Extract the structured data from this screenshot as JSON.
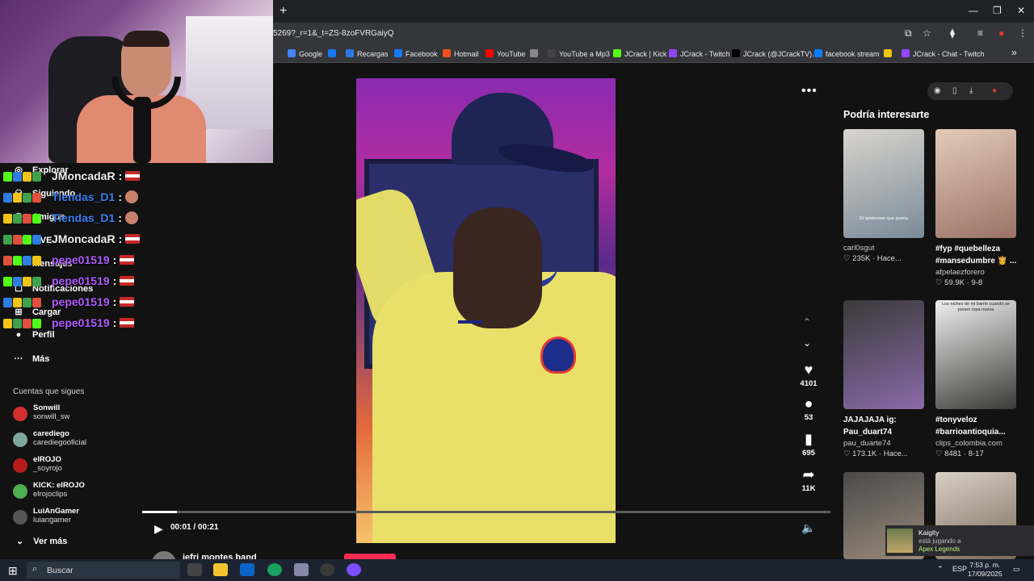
{
  "browser": {
    "new_tab": "+",
    "window_controls": [
      "—",
      "❐",
      "✕"
    ],
    "url": "5269?_r=1&_t=ZS-8zoFVRGaiyQ",
    "bookmarks": [
      {
        "label": "Google",
        "color": "#4285f4"
      },
      {
        "label": "",
        "color": "#1877f2"
      },
      {
        "label": "Recargas",
        "color": "#2a7ae2"
      },
      {
        "label": "Facebook",
        "color": "#1877f2"
      },
      {
        "label": "Hotmail",
        "color": "#f25022"
      },
      {
        "label": "YouTube",
        "color": "#ff0000"
      },
      {
        "label": "",
        "color": "#888888"
      },
      {
        "label": "YouTube a Mp3",
        "color": "#444444"
      },
      {
        "label": "JCrack | Kick",
        "color": "#53fc18"
      },
      {
        "label": "JCrack - Twitch",
        "color": "#9146ff"
      },
      {
        "label": "JCrack (@JCrackTV)...",
        "color": "#000000"
      },
      {
        "label": "facebook stream",
        "color": "#0a7cff"
      },
      {
        "label": "",
        "color": "#f1c40f"
      },
      {
        "label": "JCrack - Chat - Twitch",
        "color": "#9146ff"
      }
    ],
    "more_bookmarks": "»"
  },
  "chat": [
    {
      "user": "JMoncadaR",
      "sep": ":",
      "color": "#f0f0f0",
      "extra": "flag"
    },
    {
      "user": "Tiendas_D1",
      "sep": ":",
      "color": "#3b7ff2",
      "extra": "emote"
    },
    {
      "user": "Tiendas_D1",
      "sep": ":",
      "color": "#3b7ff2",
      "extra": "emote"
    },
    {
      "user": "JMoncadaR",
      "sep": ":",
      "color": "#f0f0f0",
      "extra": "flag"
    },
    {
      "user": "pepe01519",
      "sep": ":",
      "color": "#b05cff",
      "extra": "flag"
    },
    {
      "user": "pepe01519",
      "sep": ":",
      "color": "#b05cff",
      "extra": "flag"
    },
    {
      "user": "pepe01519",
      "sep": ":",
      "color": "#b05cff",
      "extra": "flag"
    },
    {
      "user": "pepe01519",
      "sep": ":",
      "color": "#b05cff",
      "extra": "flag"
    }
  ],
  "sidebar": {
    "nav": [
      "Explorar",
      "Siguiendo",
      "Amigos",
      "LIVE",
      "Mensajes",
      "Notificaciones",
      "Cargar",
      "Perfil",
      "Más"
    ],
    "following_title": "Cuentas que sigues",
    "following": [
      {
        "name": "Sonwill",
        "handle": "sonwill_sw",
        "color": "#d32f2f"
      },
      {
        "name": "carediego",
        "handle": "carediegooficial",
        "color": "#7fa6a0"
      },
      {
        "name": "elROJO",
        "handle": "_soyrojo",
        "color": "#b71c1c"
      },
      {
        "name": "KICK: elROJO",
        "handle": "elrojoclips",
        "color": "#4caf50"
      },
      {
        "name": "LuiAnGamer",
        "handle": "luiangamer",
        "color": "#555"
      }
    ],
    "see_more": "Ver más"
  },
  "player": {
    "likes": "4101",
    "comments": "53",
    "saves": "695",
    "shares": "11K",
    "time": "00:01 / 00:21",
    "progress": 0.05,
    "author": "jefri montes band"
  },
  "right_panel": {
    "title": "Podría interesarte",
    "cards": [
      {
        "thumb_text": "El spiderman que queria",
        "title": "",
        "user": "carl0sgut",
        "meta": "♡ 235K · Hace...",
        "colors": [
          "#d9d5cc",
          "#7a8a9a"
        ]
      },
      {
        "thumb_text": "",
        "title": "#fyp #quebelleza #mansedumbre 👸 ...",
        "user": "afpelaezforero",
        "meta": "♡ 59.9K · 9-8",
        "colors": [
          "#e3cbb9",
          "#9a7264"
        ]
      },
      {
        "thumb_text": "",
        "title": "JAJAJAJA ig: Pau_duart74",
        "user": "pau_duarte74",
        "meta": "♡ 173.1K · Hace...",
        "colors": [
          "#3a3a3a",
          "#8a6aa8"
        ]
      },
      {
        "thumb_text": "Los niches de mi barrio cuando se ponen ropa nueva",
        "title": "#tonyveloz #barrioantioquia...",
        "user": "clips_colombia.com",
        "meta": "♡ 8481 · 8-17",
        "colors": [
          "#f0f0f0",
          "#3a3a38"
        ]
      },
      {
        "thumb_text": "",
        "title": "",
        "user": "",
        "meta": "",
        "colors": [
          "#4a4a4a",
          "#9a8a7a"
        ]
      },
      {
        "thumb_text": "",
        "title": "",
        "user": "",
        "meta": "",
        "colors": [
          "#d8d0c4",
          "#7a6a5a"
        ]
      }
    ]
  },
  "twitch_popup": {
    "name": "Kaiglty",
    "status": "está jugando a",
    "game": "Apex Legends"
  },
  "taskbar": {
    "search": "Buscar",
    "lang": "ESP",
    "time": "7:53 p. m.",
    "date": "17/09/2025"
  }
}
